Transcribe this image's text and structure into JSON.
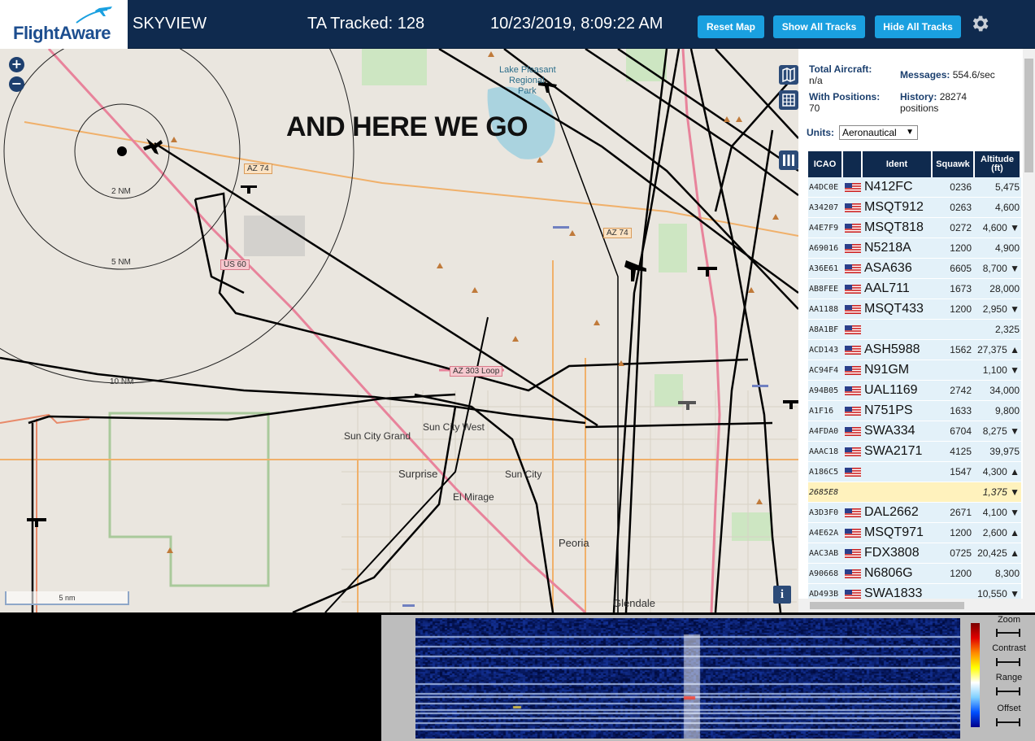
{
  "header": {
    "logo_text": "FlightAware",
    "app_name": "SKYVIEW",
    "ta_tracked": "TA Tracked: 128",
    "datetime": "10/23/2019, 8:09:22 AM",
    "buttons": {
      "reset": "Reset Map",
      "show_all": "Show All Tracks",
      "hide_all": "Hide All Tracks"
    }
  },
  "map": {
    "overlay_text": "AND HERE WE GO",
    "scale_label": "5 nm",
    "range_rings": [
      "2 NM",
      "5 NM",
      "10 NM"
    ],
    "place_labels": {
      "lake": "Lake Pleasant",
      "lake2": "Regional",
      "lake3": "Park",
      "surprise": "Surprise",
      "sun_city": "Sun City",
      "sun_city_west": "Sun City West",
      "sun_city_grand": "Sun City Grand",
      "el_mirage": "El Mirage",
      "peoria": "Peoria",
      "glendale": "Glendale"
    },
    "road_labels": {
      "az74a": "AZ 74",
      "az74b": "AZ 74",
      "us60": "US 60",
      "az303": "AZ 303 Loop"
    },
    "info_label": "i"
  },
  "sidebar": {
    "total_aircraft_label": "Total Aircraft:",
    "total_aircraft_value": "n/a",
    "with_positions_label": "With Positions:",
    "with_positions_value": "70",
    "messages_label": "Messages:",
    "messages_value": "554.6/sec",
    "history_label": "History:",
    "history_value": "28274",
    "history_unit": "positions",
    "units_label": "Units:",
    "units_value": "Aeronautical",
    "columns": [
      "ICAO",
      "",
      "Ident",
      "Squawk",
      "Altitude (ft)"
    ],
    "rows": [
      {
        "icao": "A4DC0E",
        "ident": "N412FC",
        "squawk": "0236",
        "alt": "5,475"
      },
      {
        "icao": "A34207",
        "ident": "MSQT912",
        "squawk": "0263",
        "alt": "4,600"
      },
      {
        "icao": "A4E7F9",
        "ident": "MSQT818",
        "squawk": "0272",
        "alt": "4,600 ▼"
      },
      {
        "icao": "A69016",
        "ident": "N5218A",
        "squawk": "1200",
        "alt": "4,900"
      },
      {
        "icao": "A36E61",
        "ident": "ASA636",
        "squawk": "6605",
        "alt": "8,700 ▼"
      },
      {
        "icao": "AB8FEE",
        "ident": "AAL711",
        "squawk": "1673",
        "alt": "28,000"
      },
      {
        "icao": "AA1188",
        "ident": "MSQT433",
        "squawk": "1200",
        "alt": "2,950 ▼"
      },
      {
        "icao": "A8A1BF",
        "ident": "",
        "squawk": "",
        "alt": "2,325"
      },
      {
        "icao": "ACD143",
        "ident": "ASH5988",
        "squawk": "1562",
        "alt": "27,375 ▲"
      },
      {
        "icao": "AC94F4",
        "ident": "N91GM",
        "squawk": "",
        "alt": "1,100 ▼"
      },
      {
        "icao": "A94B05",
        "ident": "UAL1169",
        "squawk": "2742",
        "alt": "34,000"
      },
      {
        "icao": "A1F16",
        "ident": "N751PS",
        "squawk": "1633",
        "alt": "9,800"
      },
      {
        "icao": "A4FDA0",
        "ident": "SWA334",
        "squawk": "6704",
        "alt": "8,275 ▼"
      },
      {
        "icao": "AAAC18",
        "ident": "SWA2171",
        "squawk": "4125",
        "alt": "39,975"
      },
      {
        "icao": "A186C5",
        "ident": "",
        "squawk": "1547",
        "alt": "4,300 ▲"
      },
      {
        "icao": "2685E8",
        "ident": "",
        "squawk": "",
        "alt": "1,375 ▼"
      },
      {
        "icao": "A3D3F0",
        "ident": "DAL2662",
        "squawk": "2671",
        "alt": "4,100 ▼"
      },
      {
        "icao": "A4E62A",
        "ident": "MSQT971",
        "squawk": "1200",
        "alt": "2,600 ▲"
      },
      {
        "icao": "AAC3AB",
        "ident": "FDX3808",
        "squawk": "0725",
        "alt": "20,425 ▲"
      },
      {
        "icao": "A90668",
        "ident": "N6806G",
        "squawk": "1200",
        "alt": "8,300"
      },
      {
        "icao": "AD493B",
        "ident": "SWA1833",
        "squawk": "",
        "alt": "10,550 ▼"
      }
    ]
  },
  "spectrum": {
    "controls": [
      "Zoom",
      "Contrast",
      "Range",
      "Offset"
    ]
  },
  "colors": {
    "header_bg": "#0f2a4e",
    "button_bg": "#1aa0e0",
    "row_bg": "#e3f1f9",
    "row_selected": "#fff2bd"
  },
  "icons": [
    "gear-icon",
    "map-layer-icon",
    "grid-icon",
    "columns-icon",
    "zoom-in-icon",
    "zoom-out-icon",
    "us-flag-icon"
  ]
}
